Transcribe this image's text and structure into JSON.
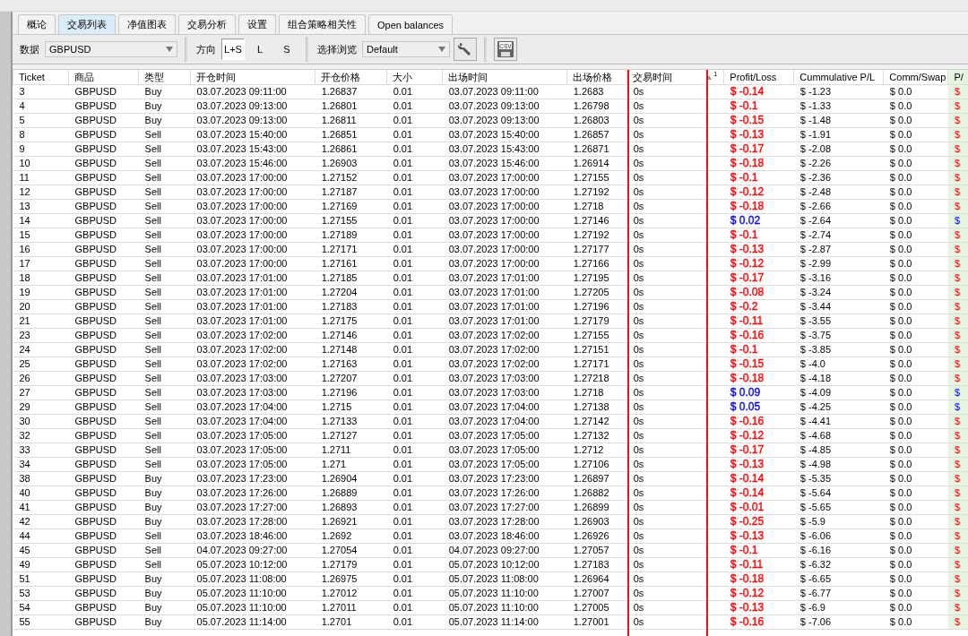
{
  "tabs": [
    {
      "label": "概论",
      "selected": false
    },
    {
      "label": "交易列表",
      "selected": true
    },
    {
      "label": "净值图表",
      "selected": false
    },
    {
      "label": "交易分析",
      "selected": false
    },
    {
      "label": "设置",
      "selected": false
    },
    {
      "label": "组合策略相关性",
      "selected": false
    },
    {
      "label": "Open balances",
      "selected": false
    }
  ],
  "toolbar": {
    "data_label": "数据",
    "data_value": "GBPUSD",
    "direction_label": "方向",
    "directions": [
      {
        "label": "L+S",
        "selected": true
      },
      {
        "label": "L",
        "selected": false
      },
      {
        "label": "S",
        "selected": false
      }
    ],
    "view_label": "选择浏览",
    "view_value": "Default",
    "csv_label": "CSV"
  },
  "table": {
    "columns": [
      "Ticket",
      "商品",
      "类型",
      "开仓时间",
      "开仓价格",
      "大小",
      "出场时间",
      "出场价格",
      "交易时间",
      "Profit/Loss",
      "Cummulative P/L",
      "Comm/Swap",
      "P/"
    ],
    "sort_index": "1",
    "rows": [
      {
        "ticket": "3",
        "symbol": "GBPUSD",
        "type": "Buy",
        "open_time": "03.07.2023 09:11:00",
        "open_price": "1.26837",
        "size": "0.01",
        "exit_time": "03.07.2023 09:11:00",
        "exit_price": "1.2683",
        "duration": "0s",
        "pl": "$ -0.14",
        "color": "#ff0000",
        "cum": "$ -1.23",
        "comm": "$ 0.0",
        "column_13": "$"
      },
      {
        "ticket": "4",
        "symbol": "GBPUSD",
        "type": "Buy",
        "open_time": "03.07.2023 09:13:00",
        "open_price": "1.26801",
        "size": "0.01",
        "exit_time": "03.07.2023 09:13:00",
        "exit_price": "1.26798",
        "duration": "0s",
        "pl": "$ -0.1",
        "color": "#ff0000",
        "cum": "$ -1.33",
        "comm": "$ 0.0",
        "column_13": "$"
      },
      {
        "ticket": "5",
        "symbol": "GBPUSD",
        "type": "Buy",
        "open_time": "03.07.2023 09:13:00",
        "open_price": "1.26811",
        "size": "0.01",
        "exit_time": "03.07.2023 09:13:00",
        "exit_price": "1.26803",
        "duration": "0s",
        "pl": "$ -0.15",
        "color": "#ff0000",
        "cum": "$ -1.48",
        "comm": "$ 0.0",
        "column_13": "$"
      },
      {
        "ticket": "8",
        "symbol": "GBPUSD",
        "type": "Sell",
        "open_time": "03.07.2023 15:40:00",
        "open_price": "1.26851",
        "size": "0.01",
        "exit_time": "03.07.2023 15:40:00",
        "exit_price": "1.26857",
        "duration": "0s",
        "pl": "$ -0.13",
        "color": "#ff0000",
        "cum": "$ -1.91",
        "comm": "$ 0.0",
        "column_13": "$"
      },
      {
        "ticket": "9",
        "symbol": "GBPUSD",
        "type": "Sell",
        "open_time": "03.07.2023 15:43:00",
        "open_price": "1.26861",
        "size": "0.01",
        "exit_time": "03.07.2023 15:43:00",
        "exit_price": "1.26871",
        "duration": "0s",
        "pl": "$ -0.17",
        "color": "#ff0000",
        "cum": "$ -2.08",
        "comm": "$ 0.0",
        "column_13": "$"
      },
      {
        "ticket": "10",
        "symbol": "GBPUSD",
        "type": "Sell",
        "open_time": "03.07.2023 15:46:00",
        "open_price": "1.26903",
        "size": "0.01",
        "exit_time": "03.07.2023 15:46:00",
        "exit_price": "1.26914",
        "duration": "0s",
        "pl": "$ -0.18",
        "color": "#ff0000",
        "cum": "$ -2.26",
        "comm": "$ 0.0",
        "column_13": "$"
      },
      {
        "ticket": "11",
        "symbol": "GBPUSD",
        "type": "Sell",
        "open_time": "03.07.2023 17:00:00",
        "open_price": "1.27152",
        "size": "0.01",
        "exit_time": "03.07.2023 17:00:00",
        "exit_price": "1.27155",
        "duration": "0s",
        "pl": "$ -0.1",
        "color": "#ff0000",
        "cum": "$ -2.36",
        "comm": "$ 0.0",
        "column_13": "$"
      },
      {
        "ticket": "12",
        "symbol": "GBPUSD",
        "type": "Sell",
        "open_time": "03.07.2023 17:00:00",
        "open_price": "1.27187",
        "size": "0.01",
        "exit_time": "03.07.2023 17:00:00",
        "exit_price": "1.27192",
        "duration": "0s",
        "pl": "$ -0.12",
        "color": "#ff0000",
        "cum": "$ -2.48",
        "comm": "$ 0.0",
        "column_13": "$"
      },
      {
        "ticket": "13",
        "symbol": "GBPUSD",
        "type": "Sell",
        "open_time": "03.07.2023 17:00:00",
        "open_price": "1.27169",
        "size": "0.01",
        "exit_time": "03.07.2023 17:00:00",
        "exit_price": "1.2718",
        "duration": "0s",
        "pl": "$ -0.18",
        "color": "#ff0000",
        "cum": "$ -2.66",
        "comm": "$ 0.0",
        "column_13": "$"
      },
      {
        "ticket": "14",
        "symbol": "GBPUSD",
        "type": "Sell",
        "open_time": "03.07.2023 17:00:00",
        "open_price": "1.27155",
        "size": "0.01",
        "exit_time": "03.07.2023 17:00:00",
        "exit_price": "1.27146",
        "duration": "0s",
        "pl": "$ 0.02",
        "color": "#0000ff",
        "cum": "$ -2.64",
        "comm": "$ 0.0",
        "column_13": "$"
      },
      {
        "ticket": "15",
        "symbol": "GBPUSD",
        "type": "Sell",
        "open_time": "03.07.2023 17:00:00",
        "open_price": "1.27189",
        "size": "0.01",
        "exit_time": "03.07.2023 17:00:00",
        "exit_price": "1.27192",
        "duration": "0s",
        "pl": "$ -0.1",
        "color": "#ff0000",
        "cum": "$ -2.74",
        "comm": "$ 0.0",
        "column_13": "$"
      },
      {
        "ticket": "16",
        "symbol": "GBPUSD",
        "type": "Sell",
        "open_time": "03.07.2023 17:00:00",
        "open_price": "1.27171",
        "size": "0.01",
        "exit_time": "03.07.2023 17:00:00",
        "exit_price": "1.27177",
        "duration": "0s",
        "pl": "$ -0.13",
        "color": "#ff0000",
        "cum": "$ -2.87",
        "comm": "$ 0.0",
        "column_13": "$"
      },
      {
        "ticket": "17",
        "symbol": "GBPUSD",
        "type": "Sell",
        "open_time": "03.07.2023 17:00:00",
        "open_price": "1.27161",
        "size": "0.01",
        "exit_time": "03.07.2023 17:00:00",
        "exit_price": "1.27166",
        "duration": "0s",
        "pl": "$ -0.12",
        "color": "#ff0000",
        "cum": "$ -2.99",
        "comm": "$ 0.0",
        "column_13": "$"
      },
      {
        "ticket": "18",
        "symbol": "GBPUSD",
        "type": "Sell",
        "open_time": "03.07.2023 17:01:00",
        "open_price": "1.27185",
        "size": "0.01",
        "exit_time": "03.07.2023 17:01:00",
        "exit_price": "1.27195",
        "duration": "0s",
        "pl": "$ -0.17",
        "color": "#ff0000",
        "cum": "$ -3.16",
        "comm": "$ 0.0",
        "column_13": "$"
      },
      {
        "ticket": "19",
        "symbol": "GBPUSD",
        "type": "Sell",
        "open_time": "03.07.2023 17:01:00",
        "open_price": "1.27204",
        "size": "0.01",
        "exit_time": "03.07.2023 17:01:00",
        "exit_price": "1.27205",
        "duration": "0s",
        "pl": "$ -0.08",
        "color": "#ff0000",
        "cum": "$ -3.24",
        "comm": "$ 0.0",
        "column_13": "$"
      },
      {
        "ticket": "20",
        "symbol": "GBPUSD",
        "type": "Sell",
        "open_time": "03.07.2023 17:01:00",
        "open_price": "1.27183",
        "size": "0.01",
        "exit_time": "03.07.2023 17:01:00",
        "exit_price": "1.27196",
        "duration": "0s",
        "pl": "$ -0.2",
        "color": "#ff0000",
        "cum": "$ -3.44",
        "comm": "$ 0.0",
        "column_13": "$"
      },
      {
        "ticket": "21",
        "symbol": "GBPUSD",
        "type": "Sell",
        "open_time": "03.07.2023 17:01:00",
        "open_price": "1.27175",
        "size": "0.01",
        "exit_time": "03.07.2023 17:01:00",
        "exit_price": "1.27179",
        "duration": "0s",
        "pl": "$ -0.11",
        "color": "#ff0000",
        "cum": "$ -3.55",
        "comm": "$ 0.0",
        "column_13": "$"
      },
      {
        "ticket": "23",
        "symbol": "GBPUSD",
        "type": "Sell",
        "open_time": "03.07.2023 17:02:00",
        "open_price": "1.27146",
        "size": "0.01",
        "exit_time": "03.07.2023 17:02:00",
        "exit_price": "1.27155",
        "duration": "0s",
        "pl": "$ -0.16",
        "color": "#ff0000",
        "cum": "$ -3.75",
        "comm": "$ 0.0",
        "column_13": "$"
      },
      {
        "ticket": "24",
        "symbol": "GBPUSD",
        "type": "Sell",
        "open_time": "03.07.2023 17:02:00",
        "open_price": "1.27148",
        "size": "0.01",
        "exit_time": "03.07.2023 17:02:00",
        "exit_price": "1.27151",
        "duration": "0s",
        "pl": "$ -0.1",
        "color": "#ff0000",
        "cum": "$ -3.85",
        "comm": "$ 0.0",
        "column_13": "$"
      },
      {
        "ticket": "25",
        "symbol": "GBPUSD",
        "type": "Sell",
        "open_time": "03.07.2023 17:02:00",
        "open_price": "1.27163",
        "size": "0.01",
        "exit_time": "03.07.2023 17:02:00",
        "exit_price": "1.27171",
        "duration": "0s",
        "pl": "$ -0.15",
        "color": "#ff0000",
        "cum": "$ -4.0",
        "comm": "$ 0.0",
        "column_13": "$"
      },
      {
        "ticket": "26",
        "symbol": "GBPUSD",
        "type": "Sell",
        "open_time": "03.07.2023 17:03:00",
        "open_price": "1.27207",
        "size": "0.01",
        "exit_time": "03.07.2023 17:03:00",
        "exit_price": "1.27218",
        "duration": "0s",
        "pl": "$ -0.18",
        "color": "#ff0000",
        "cum": "$ -4.18",
        "comm": "$ 0.0",
        "column_13": "$"
      },
      {
        "ticket": "27",
        "symbol": "GBPUSD",
        "type": "Sell",
        "open_time": "03.07.2023 17:03:00",
        "open_price": "1.27196",
        "size": "0.01",
        "exit_time": "03.07.2023 17:03:00",
        "exit_price": "1.2718",
        "duration": "0s",
        "pl": "$ 0.09",
        "color": "#0000ff",
        "cum": "$ -4.09",
        "comm": "$ 0.0",
        "column_13": "$"
      },
      {
        "ticket": "29",
        "symbol": "GBPUSD",
        "type": "Sell",
        "open_time": "03.07.2023 17:04:00",
        "open_price": "1.2715",
        "size": "0.01",
        "exit_time": "03.07.2023 17:04:00",
        "exit_price": "1.27138",
        "duration": "0s",
        "pl": "$ 0.05",
        "color": "#0000ff",
        "cum": "$ -4.25",
        "comm": "$ 0.0",
        "column_13": "$"
      },
      {
        "ticket": "30",
        "symbol": "GBPUSD",
        "type": "Sell",
        "open_time": "03.07.2023 17:04:00",
        "open_price": "1.27133",
        "size": "0.01",
        "exit_time": "03.07.2023 17:04:00",
        "exit_price": "1.27142",
        "duration": "0s",
        "pl": "$ -0.16",
        "color": "#ff0000",
        "cum": "$ -4.41",
        "comm": "$ 0.0",
        "column_13": "$"
      },
      {
        "ticket": "32",
        "symbol": "GBPUSD",
        "type": "Sell",
        "open_time": "03.07.2023 17:05:00",
        "open_price": "1.27127",
        "size": "0.01",
        "exit_time": "03.07.2023 17:05:00",
        "exit_price": "1.27132",
        "duration": "0s",
        "pl": "$ -0.12",
        "color": "#ff0000",
        "cum": "$ -4.68",
        "comm": "$ 0.0",
        "column_13": "$"
      },
      {
        "ticket": "33",
        "symbol": "GBPUSD",
        "type": "Sell",
        "open_time": "03.07.2023 17:05:00",
        "open_price": "1.2711",
        "size": "0.01",
        "exit_time": "03.07.2023 17:05:00",
        "exit_price": "1.2712",
        "duration": "0s",
        "pl": "$ -0.17",
        "color": "#ff0000",
        "cum": "$ -4.85",
        "comm": "$ 0.0",
        "column_13": "$"
      },
      {
        "ticket": "34",
        "symbol": "GBPUSD",
        "type": "Sell",
        "open_time": "03.07.2023 17:05:00",
        "open_price": "1.271",
        "size": "0.01",
        "exit_time": "03.07.2023 17:05:00",
        "exit_price": "1.27106",
        "duration": "0s",
        "pl": "$ -0.13",
        "color": "#ff0000",
        "cum": "$ -4.98",
        "comm": "$ 0.0",
        "column_13": "$"
      },
      {
        "ticket": "38",
        "symbol": "GBPUSD",
        "type": "Buy",
        "open_time": "03.07.2023 17:23:00",
        "open_price": "1.26904",
        "size": "0.01",
        "exit_time": "03.07.2023 17:23:00",
        "exit_price": "1.26897",
        "duration": "0s",
        "pl": "$ -0.14",
        "color": "#ff0000",
        "cum": "$ -5.35",
        "comm": "$ 0.0",
        "column_13": "$"
      },
      {
        "ticket": "40",
        "symbol": "GBPUSD",
        "type": "Buy",
        "open_time": "03.07.2023 17:26:00",
        "open_price": "1.26889",
        "size": "0.01",
        "exit_time": "03.07.2023 17:26:00",
        "exit_price": "1.26882",
        "duration": "0s",
        "pl": "$ -0.14",
        "color": "#ff0000",
        "cum": "$ -5.64",
        "comm": "$ 0.0",
        "column_13": "$"
      },
      {
        "ticket": "41",
        "symbol": "GBPUSD",
        "type": "Buy",
        "open_time": "03.07.2023 17:27:00",
        "open_price": "1.26893",
        "size": "0.01",
        "exit_time": "03.07.2023 17:27:00",
        "exit_price": "1.26899",
        "duration": "0s",
        "pl": "$ -0.01",
        "color": "#ff0000",
        "cum": "$ -5.65",
        "comm": "$ 0.0",
        "column_13": "$"
      },
      {
        "ticket": "42",
        "symbol": "GBPUSD",
        "type": "Buy",
        "open_time": "03.07.2023 17:28:00",
        "open_price": "1.26921",
        "size": "0.01",
        "exit_time": "03.07.2023 17:28:00",
        "exit_price": "1.26903",
        "duration": "0s",
        "pl": "$ -0.25",
        "color": "#ff0000",
        "cum": "$ -5.9",
        "comm": "$ 0.0",
        "column_13": "$"
      },
      {
        "ticket": "44",
        "symbol": "GBPUSD",
        "type": "Sell",
        "open_time": "03.07.2023 18:46:00",
        "open_price": "1.2692",
        "size": "0.01",
        "exit_time": "03.07.2023 18:46:00",
        "exit_price": "1.26926",
        "duration": "0s",
        "pl": "$ -0.13",
        "color": "#ff0000",
        "cum": "$ -6.06",
        "comm": "$ 0.0",
        "column_13": "$"
      },
      {
        "ticket": "45",
        "symbol": "GBPUSD",
        "type": "Sell",
        "open_time": "04.07.2023 09:27:00",
        "open_price": "1.27054",
        "size": "0.01",
        "exit_time": "04.07.2023 09:27:00",
        "exit_price": "1.27057",
        "duration": "0s",
        "pl": "$ -0.1",
        "color": "#ff0000",
        "cum": "$ -6.16",
        "comm": "$ 0.0",
        "column_13": "$"
      },
      {
        "ticket": "49",
        "symbol": "GBPUSD",
        "type": "Sell",
        "open_time": "05.07.2023 10:12:00",
        "open_price": "1.27179",
        "size": "0.01",
        "exit_time": "05.07.2023 10:12:00",
        "exit_price": "1.27183",
        "duration": "0s",
        "pl": "$ -0.11",
        "color": "#ff0000",
        "cum": "$ -6.32",
        "comm": "$ 0.0",
        "column_13": "$"
      },
      {
        "ticket": "51",
        "symbol": "GBPUSD",
        "type": "Buy",
        "open_time": "05.07.2023 11:08:00",
        "open_price": "1.26975",
        "size": "0.01",
        "exit_time": "05.07.2023 11:08:00",
        "exit_price": "1.26964",
        "duration": "0s",
        "pl": "$ -0.18",
        "color": "#ff0000",
        "cum": "$ -6.65",
        "comm": "$ 0.0",
        "column_13": "$"
      },
      {
        "ticket": "53",
        "symbol": "GBPUSD",
        "type": "Buy",
        "open_time": "05.07.2023 11:10:00",
        "open_price": "1.27012",
        "size": "0.01",
        "exit_time": "05.07.2023 11:10:00",
        "exit_price": "1.27007",
        "duration": "0s",
        "pl": "$ -0.12",
        "color": "#ff0000",
        "cum": "$ -6.77",
        "comm": "$ 0.0",
        "column_13": "$"
      },
      {
        "ticket": "54",
        "symbol": "GBPUSD",
        "type": "Buy",
        "open_time": "05.07.2023 11:10:00",
        "open_price": "1.27011",
        "size": "0.01",
        "exit_time": "05.07.2023 11:10:00",
        "exit_price": "1.27005",
        "duration": "0s",
        "pl": "$ -0.13",
        "color": "#ff0000",
        "cum": "$ -6.9",
        "comm": "$ 0.0",
        "column_13": "$"
      },
      {
        "ticket": "55",
        "symbol": "GBPUSD",
        "type": "Buy",
        "open_time": "05.07.2023 11:14:00",
        "open_price": "1.2701",
        "size": "0.01",
        "exit_time": "05.07.2023 11:14:00",
        "exit_price": "1.27001",
        "duration": "0s",
        "pl": "$ -0.16",
        "color": "#ff0000",
        "cum": "$ -7.06",
        "comm": "$ 0.0",
        "column_13": "$"
      }
    ]
  }
}
